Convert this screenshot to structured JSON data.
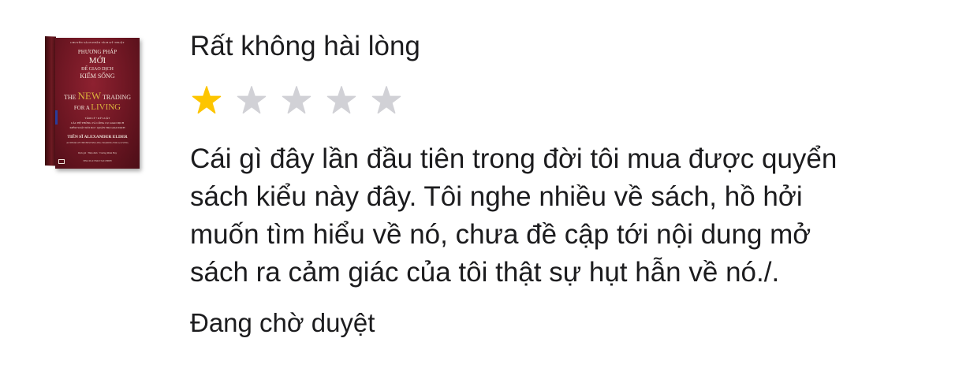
{
  "book": {
    "series": "CHUYÊN SÁCH PHÂN TÍCH KỸ THUẬT",
    "title_vn_line1": "PHƯƠNG PHÁP",
    "title_vn_line2": "MỚI",
    "title_vn_line3": "ĐỂ GIAO DỊCH",
    "title_vn_line4": "KIẾM SỐNG",
    "title_en_pre": "THE",
    "title_en_new": "NEW",
    "title_en_mid": "TRADING",
    "title_en_for": "FOR A",
    "title_en_living": "LIVING",
    "tagline1": "TÂM LÝ • KỶ LUẬT",
    "tagline2": "CÁC HỆ THỐNG VÀ CÔNG CỤ GIAO DỊCH",
    "tagline3": "KIỂM SOÁT RỦI RO • QUẢN TRỊ GIAO DỊCH",
    "author": "TIẾN SĨ ALEXANDER ELDER",
    "author_en": "AUTHOR OF THE BESTSELLING TRADING FOR A LIVING",
    "credits": "Dịch giả · Hiệu đính · Trương Minh Huy",
    "publisher": "NHÀ XUẤT BẢN TÀI CHÍNH",
    "cover_color": "#6c1622",
    "accent_color": "#d9b23c"
  },
  "review": {
    "title": "Rất không hài lòng",
    "rating": 1,
    "max_rating": 5,
    "star_filled_color": "#fdc500",
    "star_empty_color": "#d1d1d6",
    "body_lines": [
      "Cái gì đây lần đầu tiên trong đời tôi mua được quyển",
      "sách kiểu này đây. Tôi nghe nhiều về sách, hồ hởi",
      "muốn tìm hiểu về nó, chưa đề cập tới nội dung mở",
      "sách ra cảm giác của tôi thật sự hụt hẫn về nó./."
    ],
    "status": "Đang chờ duyệt"
  }
}
